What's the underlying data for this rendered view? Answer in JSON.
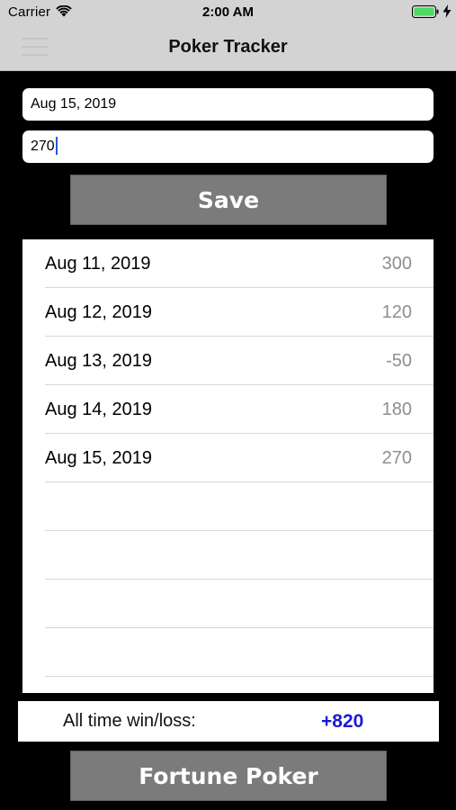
{
  "status_bar": {
    "carrier": "Carrier",
    "time": "2:00 AM",
    "wifi_icon": "wifi-icon",
    "battery_icon": "battery-icon",
    "charge_icon": "lightning-bolt-icon",
    "battery_color": "#4cd964"
  },
  "nav": {
    "title": "Poker Tracker",
    "menu_icon": "hamburger-menu-icon"
  },
  "form": {
    "date_value": "Aug 15, 2019",
    "amount_value": "270",
    "save_label": "Save"
  },
  "table": {
    "rows": [
      {
        "date": "Aug 11, 2019",
        "amount": "300"
      },
      {
        "date": "Aug 12, 2019",
        "amount": "120"
      },
      {
        "date": "Aug 13, 2019",
        "amount": "-50"
      },
      {
        "date": "Aug 14, 2019",
        "amount": "180"
      },
      {
        "date": "Aug 15, 2019",
        "amount": "270"
      }
    ]
  },
  "totals": {
    "label": "All time win/loss:",
    "value": "+820",
    "value_color": "#1a1ad6"
  },
  "footer": {
    "fortune_label": "Fortune Poker"
  },
  "colors": {
    "background": "#000000",
    "header": "#d3d3d3",
    "button": "#7b7b7b",
    "caret": "#1e5bd8"
  }
}
